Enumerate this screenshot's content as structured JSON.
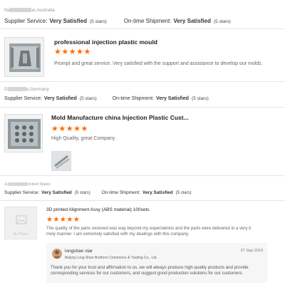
{
  "reviews": [
    {
      "reviewer_prefix": "Na",
      "reviewer_suffix": "er,Australia",
      "supplier_service_label": "Supplier Service:",
      "supplier_service_value": "Very Satisfied",
      "supplier_service_stars": "(5 stars)",
      "shipment_label": "On-time Shipment:",
      "shipment_value": "Very Satisfied",
      "shipment_stars": "(5 stars)",
      "product_title": "professional injection plastic mould",
      "rating": "★★★★★",
      "text": "Prompt and great service. Very satisfied with the support and assistance to develop our molds."
    },
    {
      "reviewer_prefix": "D",
      "reviewer_suffix": "e,Germany",
      "supplier_service_label": "Supplier Service:",
      "supplier_service_value": "Very Satisfied",
      "supplier_service_stars": "(5 stars)",
      "shipment_label": "On-time Shipment:",
      "shipment_value": "Very Satisfied",
      "shipment_stars": "(5 stars)",
      "product_title": "Mold Manufacture china Injection Plastic Cust...",
      "rating": "★★★★★",
      "text": "High Quality, great Company"
    },
    {
      "reviewer_prefix": "Ju",
      "reviewer_suffix": "United States",
      "supplier_service_label": "Supplier Service:",
      "supplier_service_value": "Very Satisfied",
      "supplier_service_stars": "(5 stars)",
      "shipment_label": "On-time Shipment:",
      "shipment_value": "Very Satisfied",
      "shipment_stars": "(5 stars)",
      "product_title": "3D printed Alignment Assy (ABS material) 100sets",
      "rating": "★★★★★",
      "text_line1": "The quality of the parts received was way beyond my expectations and the parts were delivered in a very ti",
      "text_line2": "mely manner. I am extremely satisfied with my dealings with this company.",
      "no_photo": "No Photo"
    }
  ],
  "reply": {
    "name": "longshan star",
    "company": "Beijing Long Shan Brothers Commerce & Trading Co., Ltd.",
    "date": "27 Sep 2019",
    "line1": "Thank you for your trust and affirmation to us, we will always produce high quality products and provide",
    "line2": "corresponding services for our customers, and suggest good production solutions for our customers."
  },
  "colors": {
    "star": "#ff6a00",
    "divider": "#e6e6e6",
    "reply_bg": "#f6f6f6"
  }
}
